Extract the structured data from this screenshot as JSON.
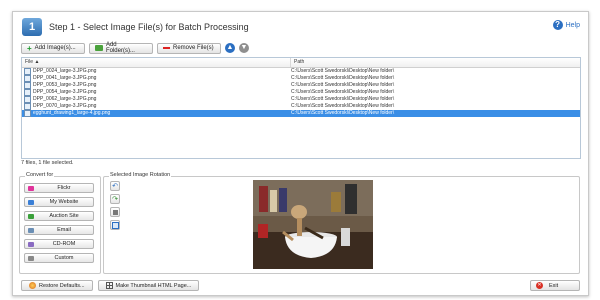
{
  "window": {
    "title": "Step 1 - Select Image File(s) for Batch Processing",
    "title_icon_glyph": "1",
    "help_label": "Help",
    "help_glyph": "?"
  },
  "toolbar": {
    "add_images_label": "Add Image(s)...",
    "add_folders_label": "Add Folder(s)...",
    "remove_files_label": "Remove File(s)",
    "up_glyph": "▲",
    "down_glyph": "▼"
  },
  "filelist": {
    "columns": {
      "file": "File ▲",
      "path": "Path"
    },
    "rows": [
      {
        "file": "DPP_0024_large-3.JPG.png",
        "path": "C:\\Users\\Scott Swedorski\\Desktop\\New folder\\"
      },
      {
        "file": "DPP_0041_large-3.JPG.png",
        "path": "C:\\Users\\Scott Swedorski\\Desktop\\New folder\\"
      },
      {
        "file": "DPP_0053_large-3.JPG.png",
        "path": "C:\\Users\\Scott Swedorski\\Desktop\\New folder\\"
      },
      {
        "file": "DPP_0054_large-3.JPG.png",
        "path": "C:\\Users\\Scott Swedorski\\Desktop\\New folder\\"
      },
      {
        "file": "DPP_0062_large-3.JPG.png",
        "path": "C:\\Users\\Scott Swedorski\\Desktop\\New folder\\"
      },
      {
        "file": "DPP_0070_large-3.JPG.png",
        "path": "C:\\Users\\Scott Swedorski\\Desktop\\New folder\\"
      },
      {
        "file": "egghunt_drawing1_large-4.jpg.png",
        "path": "C:\\Users\\Scott Swedorski\\Desktop\\New folder\\"
      }
    ],
    "selected_index": 6
  },
  "status": {
    "text": "7 files, 1 file selected."
  },
  "convert_for": {
    "label": "Convert for",
    "buttons": [
      {
        "label": "Flickr",
        "icon": "flickr-icon"
      },
      {
        "label": "My Website",
        "icon": "website-icon"
      },
      {
        "label": "Auction Site",
        "icon": "auction-icon"
      },
      {
        "label": "Email",
        "icon": "email-icon"
      },
      {
        "label": "CD-ROM",
        "icon": "cdrom-icon"
      },
      {
        "label": "Custom",
        "icon": "custom-icon"
      }
    ]
  },
  "rotation": {
    "label": "Selected Image Rotation",
    "rotate_left_glyph": "↶",
    "rotate_right_glyph": "↷"
  },
  "bottom": {
    "restore_defaults_label": "Restore Defaults...",
    "make_thumbnail_label": "Make Thumbnail HTML Page...",
    "exit_label": "Exit",
    "exit_glyph": "✕"
  },
  "colors": {
    "selection": "#3a8ee6",
    "accent": "#2b6fc2"
  }
}
